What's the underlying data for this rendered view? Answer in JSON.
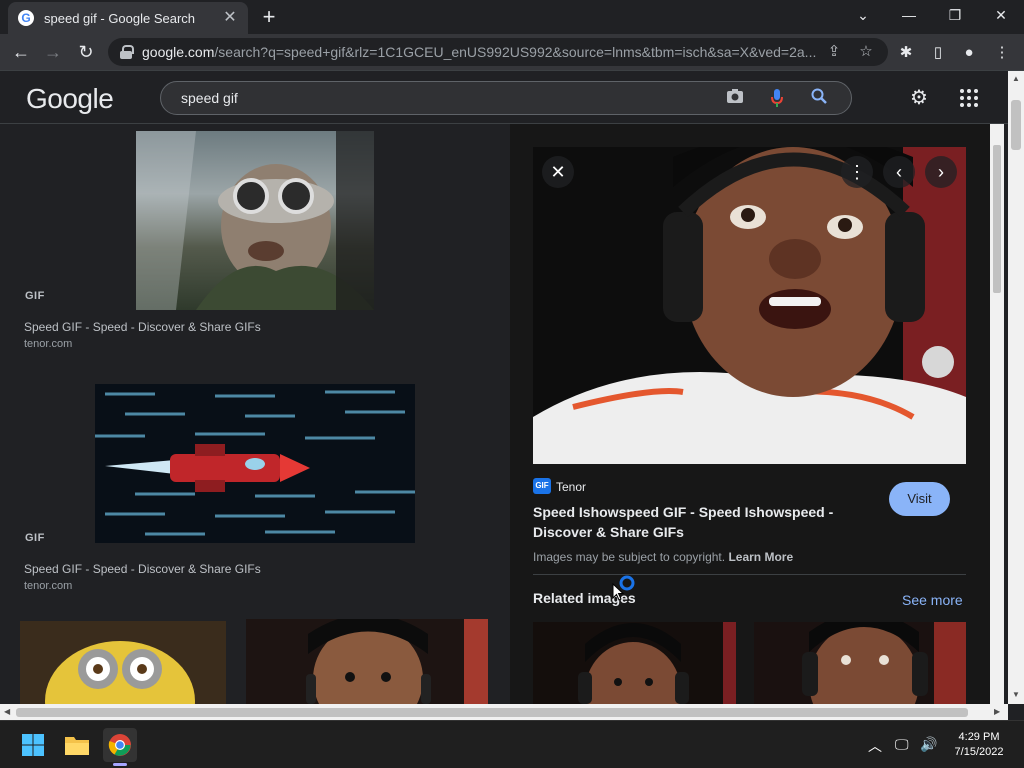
{
  "browser": {
    "tab_title": "speed gif - Google Search",
    "url_domain": "google.com",
    "url_path": "/search?q=speed+gif&rlz=1C1GCEU_enUS992US992&source=lnms&tbm=isch&sa=X&ved=2a..."
  },
  "google": {
    "logo": "Google",
    "query": "speed gif"
  },
  "results": [
    {
      "badge": "GIF",
      "title": "Speed GIF - Speed - Discover & Share GIFs",
      "source": "tenor.com"
    },
    {
      "badge": "GIF",
      "title": "Speed GIF - Speed - Discover & Share GIFs",
      "source": "tenor.com"
    }
  ],
  "preview": {
    "source_logo": "GIF",
    "source_name": "Tenor",
    "title": "Speed Ishowspeed GIF - Speed Ishowspeed - Discover & Share GIFs",
    "visit_label": "Visit",
    "copyright_text": "Images may be subject to copyright.",
    "learn_more": "Learn More",
    "related_label": "Related images",
    "see_more_label": "See more"
  },
  "taskbar": {
    "time": "4:29 PM",
    "date": "7/15/2022"
  },
  "colors": {
    "background": "#202124",
    "panel": "#171717",
    "accent": "#8ab4f8"
  }
}
